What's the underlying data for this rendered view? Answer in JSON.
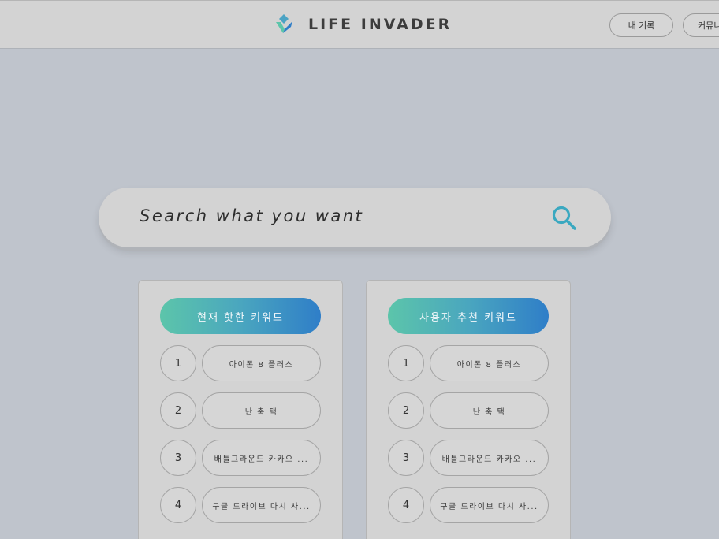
{
  "header": {
    "brand": "LIFE INVADER",
    "nav": [
      "내 기록",
      "커뮤니"
    ]
  },
  "search": {
    "placeholder": "Search what you want"
  },
  "panels": [
    {
      "title": "현재 핫한 키워드",
      "items": [
        {
          "rank": "1",
          "keyword": "아이폰 8 플러스"
        },
        {
          "rank": "2",
          "keyword": "난 축 택"
        },
        {
          "rank": "3",
          "keyword": "배틀그라운드 카카오 ..."
        },
        {
          "rank": "4",
          "keyword": "구글 드라이브 다시 사..."
        }
      ]
    },
    {
      "title": "사용자 추천 키워드",
      "items": [
        {
          "rank": "1",
          "keyword": "아이폰 8 플러스"
        },
        {
          "rank": "2",
          "keyword": "난 축 택"
        },
        {
          "rank": "3",
          "keyword": "배틀그라운드 카카오 ..."
        },
        {
          "rank": "4",
          "keyword": "구글 드라이브 다시 사..."
        }
      ]
    }
  ],
  "icons": {
    "logo": "diamond-check-logo-icon",
    "search": "search-icon"
  },
  "colors": {
    "background": "#bfc4cc",
    "surface": "#d3d3d3",
    "gradient_start": "#5cc5aa",
    "gradient_end": "#2f7ec8",
    "search_icon": "#3aa8c0"
  }
}
